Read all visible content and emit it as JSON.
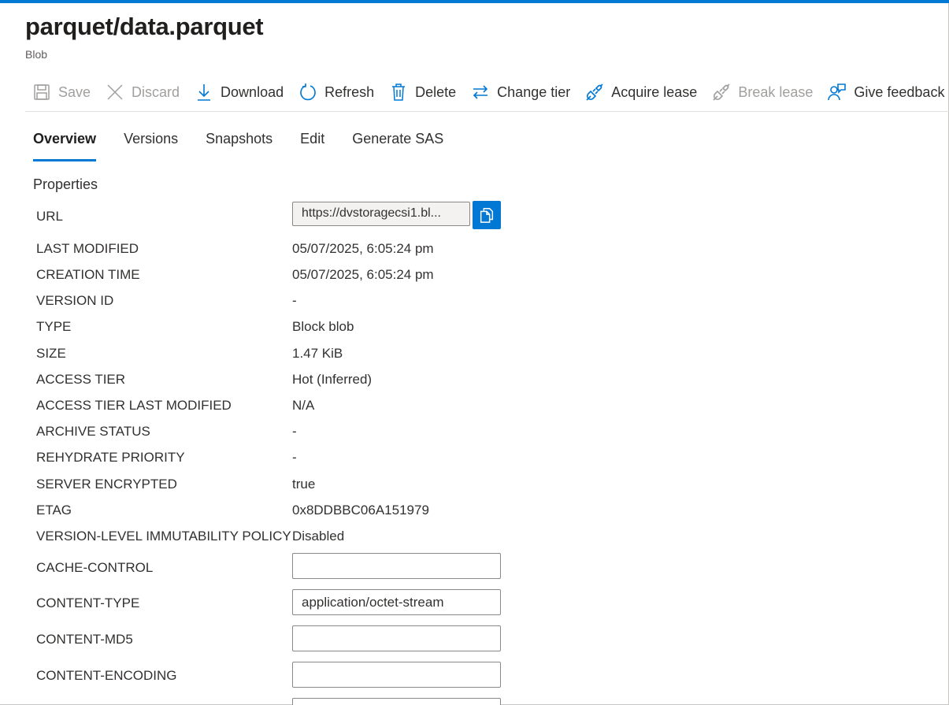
{
  "header": {
    "title": "parquet/data.parquet",
    "subtitle": "Blob"
  },
  "toolbar": {
    "items": [
      {
        "label": "Save",
        "icon": "save-icon",
        "enabled": false
      },
      {
        "label": "Discard",
        "icon": "close-icon",
        "enabled": false
      },
      {
        "label": "Download",
        "icon": "download-icon",
        "enabled": true
      },
      {
        "label": "Refresh",
        "icon": "refresh-icon",
        "enabled": true
      },
      {
        "label": "Delete",
        "icon": "trash-icon",
        "enabled": true
      },
      {
        "label": "Change tier",
        "icon": "swap-arrows-icon",
        "enabled": true
      },
      {
        "label": "Acquire lease",
        "icon": "plug-icon",
        "enabled": true
      },
      {
        "label": "Break lease",
        "icon": "plug-icon",
        "enabled": false
      },
      {
        "label": "Give feedback",
        "icon": "feedback-person-icon",
        "enabled": true
      }
    ]
  },
  "tabs": [
    {
      "label": "Overview",
      "active": true
    },
    {
      "label": "Versions",
      "active": false
    },
    {
      "label": "Snapshots",
      "active": false
    },
    {
      "label": "Edit",
      "active": false
    },
    {
      "label": "Generate SAS",
      "active": false
    }
  ],
  "properties": {
    "section_title": "Properties",
    "url": {
      "label": "URL",
      "value": "https://dvstoragecsi1.bl..."
    },
    "rows": [
      {
        "label": "LAST MODIFIED",
        "value": "05/07/2025, 6:05:24 pm"
      },
      {
        "label": "CREATION TIME",
        "value": "05/07/2025, 6:05:24 pm"
      },
      {
        "label": "VERSION ID",
        "value": "-"
      },
      {
        "label": "TYPE",
        "value": "Block blob"
      },
      {
        "label": "SIZE",
        "value": "1.47 KiB"
      },
      {
        "label": "ACCESS TIER",
        "value": "Hot (Inferred)"
      },
      {
        "label": "ACCESS TIER LAST MODIFIED",
        "value": "N/A"
      },
      {
        "label": "ARCHIVE STATUS",
        "value": "-"
      },
      {
        "label": "REHYDRATE PRIORITY",
        "value": "-"
      },
      {
        "label": "SERVER ENCRYPTED",
        "value": "true"
      },
      {
        "label": "ETAG",
        "value": "0x8DDBBC06A151979"
      },
      {
        "label": "VERSION-LEVEL IMMUTABILITY POLICY",
        "value": "Disabled"
      }
    ],
    "fields": [
      {
        "label": "CACHE-CONTROL",
        "value": ""
      },
      {
        "label": "CONTENT-TYPE",
        "value": "application/octet-stream"
      },
      {
        "label": "CONTENT-MD5",
        "value": ""
      },
      {
        "label": "CONTENT-ENCODING",
        "value": ""
      }
    ]
  },
  "colors": {
    "accent": "#0078d4",
    "text": "#323130",
    "disabled": "#a19f9d"
  }
}
